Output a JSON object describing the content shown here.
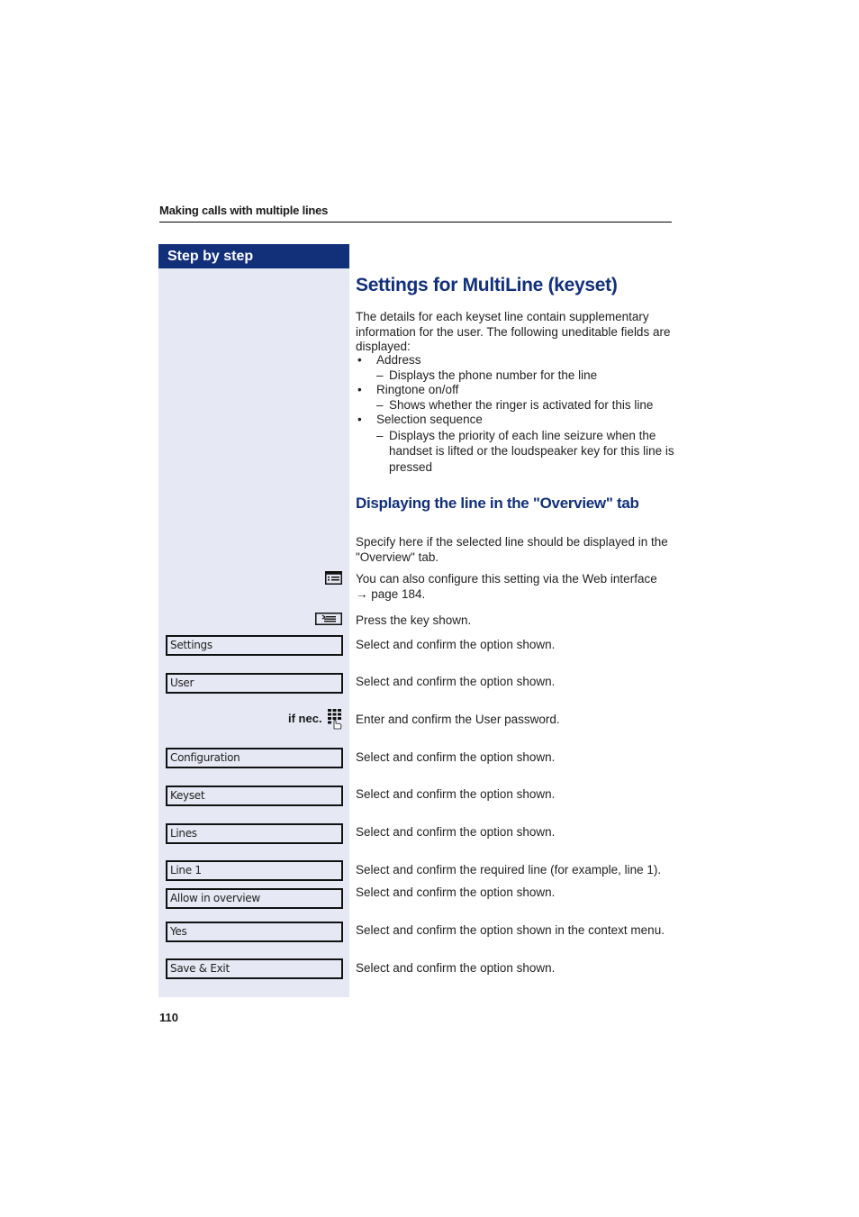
{
  "header": {
    "title": "Making calls with multiple lines"
  },
  "sidebar": {
    "heading": "Step by step"
  },
  "section": {
    "title": "Settings for MultiLine (keyset)",
    "intro": "The details for each keyset line contain supplementary information for the user. The following uneditable fields are displayed:",
    "fields": [
      {
        "label": "Address",
        "description": "Displays the phone number for the line"
      },
      {
        "label": "Ringtone on/off",
        "description": "Shows whether the ringer is activated for this line"
      },
      {
        "label": "Selection sequence",
        "description": "Displays the priority of each line seizure when the handset is lifted or the loudspeaker key for this line is pressed"
      }
    ]
  },
  "subsection": {
    "title": "Displaying the line in the \"Overview\" tab",
    "intro": "Specify here if the selected line should be displayed in the \"Overview\" tab."
  },
  "steps": [
    {
      "icon": "web-interface-icon",
      "text": "You can also configure this setting via the Web interface",
      "ref": "→ page 184."
    },
    {
      "icon": "menu-key-icon",
      "text": "Press the key shown."
    },
    {
      "option": "Settings",
      "text": "Select and confirm the option shown."
    },
    {
      "option": "User",
      "text": "Select and confirm the option shown."
    },
    {
      "prefix": "if nec.",
      "icon": "keypad-icon",
      "text": "Enter and confirm the User password."
    },
    {
      "option": "Configuration",
      "text": "Select and confirm the option shown."
    },
    {
      "option": "Keyset",
      "text": "Select and confirm the option shown."
    },
    {
      "option": "Lines",
      "text": "Select and confirm the option shown."
    },
    {
      "option": "Line 1",
      "text": "Select and confirm the required line (for example, line 1)."
    },
    {
      "option": "Allow in overview",
      "text": "Select and confirm the option shown."
    },
    {
      "option": "Yes",
      "text": "Select and confirm the option shown in the context menu."
    },
    {
      "option": "Save & Exit",
      "text": "Select and confirm the option shown."
    }
  ],
  "footer": {
    "page_number": "110"
  },
  "colors": {
    "accent": "#12307a",
    "sidebar_bg": "#e6e9f3"
  }
}
